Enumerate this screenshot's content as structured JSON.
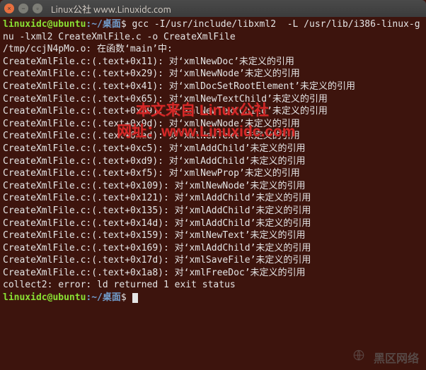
{
  "window": {
    "title": "Linux公社 www.Linuxidc.com"
  },
  "prompt": {
    "user_host": "linuxidc@ubuntu",
    "colon": ":",
    "path": "~/桌面",
    "sigil": "$"
  },
  "command": "gcc -I/usr/include/libxml2  -L /usr/lib/i386-linux-gnu -lxml2 CreateXmlFile.c -o CreateXmlFile",
  "output_lines": [
    "/tmp/ccjN4pMo.o: 在函数‘main’中:",
    "CreateXmlFile.c:(.text+0x11): 对‘xmlNewDoc’未定义的引用",
    "CreateXmlFile.c:(.text+0x29): 对‘xmlNewNode’未定义的引用",
    "CreateXmlFile.c:(.text+0x41): 对‘xmlDocSetRootElement’未定义的引用",
    "CreateXmlFile.c:(.text+0x65): 对‘xmlNewTextChild’未定义的引用",
    "CreateXmlFile.c:(.text+0x89): 对‘xmlNewTextChild’未定义的引用",
    "CreateXmlFile.c:(.text+0x9d): 对‘xmlNewNode’未定义的引用",
    "CreateXmlFile.c:(.text+0xad): 对‘xmlNewText’未定义的引用",
    "CreateXmlFile.c:(.text+0xc5): 对‘xmlAddChild’未定义的引用",
    "CreateXmlFile.c:(.text+0xd9): 对‘xmlAddChild’未定义的引用",
    "CreateXmlFile.c:(.text+0xf5): 对‘xmlNewProp’未定义的引用",
    "CreateXmlFile.c:(.text+0x109): 对‘xmlNewNode’未定义的引用",
    "CreateXmlFile.c:(.text+0x121): 对‘xmlAddChild’未定义的引用",
    "CreateXmlFile.c:(.text+0x135): 对‘xmlAddChild’未定义的引用",
    "CreateXmlFile.c:(.text+0x14d): 对‘xmlAddChild’未定义的引用",
    "CreateXmlFile.c:(.text+0x159): 对‘xmlNewText’未定义的引用",
    "CreateXmlFile.c:(.text+0x169): 对‘xmlAddChild’未定义的引用",
    "CreateXmlFile.c:(.text+0x17d): 对‘xmlSaveFile’未定义的引用",
    "CreateXmlFile.c:(.text+0x1a8): 对‘xmlFreeDoc’未定义的引用",
    "collect2: error: ld returned 1 exit status"
  ],
  "watermark": {
    "line1": "本文来自 Linux公社",
    "line2": "网址：www.Linuxidc.com",
    "bottom": "黑区网络"
  }
}
